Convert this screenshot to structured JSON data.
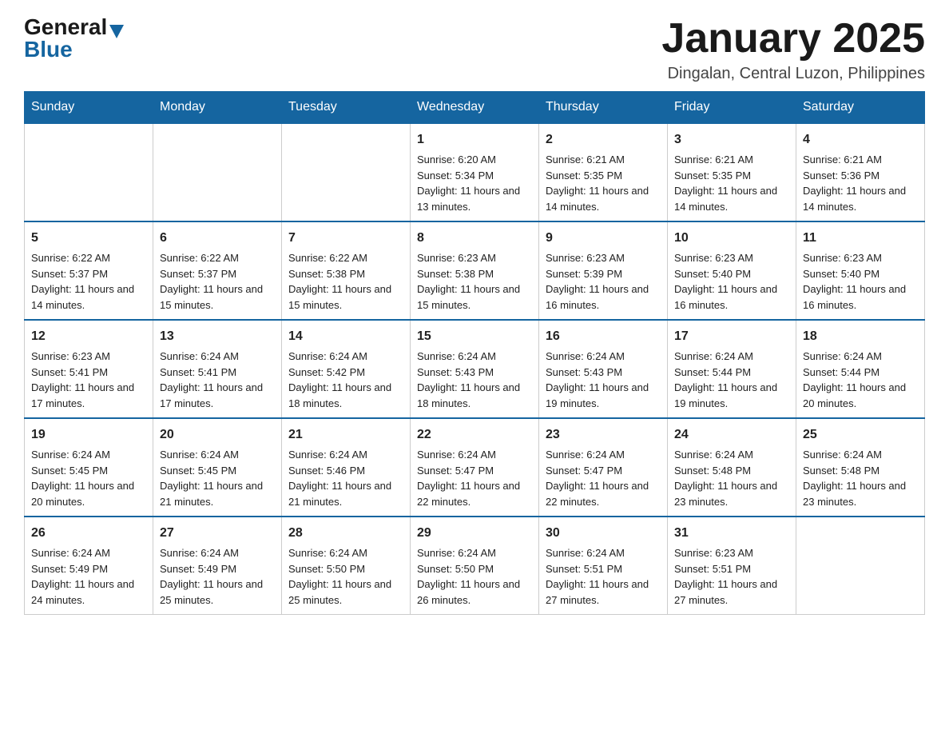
{
  "header": {
    "logo_general": "General",
    "logo_blue": "Blue",
    "title": "January 2025",
    "subtitle": "Dingalan, Central Luzon, Philippines"
  },
  "days_of_week": [
    "Sunday",
    "Monday",
    "Tuesday",
    "Wednesday",
    "Thursday",
    "Friday",
    "Saturday"
  ],
  "weeks": [
    [
      {
        "day": "",
        "info": ""
      },
      {
        "day": "",
        "info": ""
      },
      {
        "day": "",
        "info": ""
      },
      {
        "day": "1",
        "info": "Sunrise: 6:20 AM\nSunset: 5:34 PM\nDaylight: 11 hours and 13 minutes."
      },
      {
        "day": "2",
        "info": "Sunrise: 6:21 AM\nSunset: 5:35 PM\nDaylight: 11 hours and 14 minutes."
      },
      {
        "day": "3",
        "info": "Sunrise: 6:21 AM\nSunset: 5:35 PM\nDaylight: 11 hours and 14 minutes."
      },
      {
        "day": "4",
        "info": "Sunrise: 6:21 AM\nSunset: 5:36 PM\nDaylight: 11 hours and 14 minutes."
      }
    ],
    [
      {
        "day": "5",
        "info": "Sunrise: 6:22 AM\nSunset: 5:37 PM\nDaylight: 11 hours and 14 minutes."
      },
      {
        "day": "6",
        "info": "Sunrise: 6:22 AM\nSunset: 5:37 PM\nDaylight: 11 hours and 15 minutes."
      },
      {
        "day": "7",
        "info": "Sunrise: 6:22 AM\nSunset: 5:38 PM\nDaylight: 11 hours and 15 minutes."
      },
      {
        "day": "8",
        "info": "Sunrise: 6:23 AM\nSunset: 5:38 PM\nDaylight: 11 hours and 15 minutes."
      },
      {
        "day": "9",
        "info": "Sunrise: 6:23 AM\nSunset: 5:39 PM\nDaylight: 11 hours and 16 minutes."
      },
      {
        "day": "10",
        "info": "Sunrise: 6:23 AM\nSunset: 5:40 PM\nDaylight: 11 hours and 16 minutes."
      },
      {
        "day": "11",
        "info": "Sunrise: 6:23 AM\nSunset: 5:40 PM\nDaylight: 11 hours and 16 minutes."
      }
    ],
    [
      {
        "day": "12",
        "info": "Sunrise: 6:23 AM\nSunset: 5:41 PM\nDaylight: 11 hours and 17 minutes."
      },
      {
        "day": "13",
        "info": "Sunrise: 6:24 AM\nSunset: 5:41 PM\nDaylight: 11 hours and 17 minutes."
      },
      {
        "day": "14",
        "info": "Sunrise: 6:24 AM\nSunset: 5:42 PM\nDaylight: 11 hours and 18 minutes."
      },
      {
        "day": "15",
        "info": "Sunrise: 6:24 AM\nSunset: 5:43 PM\nDaylight: 11 hours and 18 minutes."
      },
      {
        "day": "16",
        "info": "Sunrise: 6:24 AM\nSunset: 5:43 PM\nDaylight: 11 hours and 19 minutes."
      },
      {
        "day": "17",
        "info": "Sunrise: 6:24 AM\nSunset: 5:44 PM\nDaylight: 11 hours and 19 minutes."
      },
      {
        "day": "18",
        "info": "Sunrise: 6:24 AM\nSunset: 5:44 PM\nDaylight: 11 hours and 20 minutes."
      }
    ],
    [
      {
        "day": "19",
        "info": "Sunrise: 6:24 AM\nSunset: 5:45 PM\nDaylight: 11 hours and 20 minutes."
      },
      {
        "day": "20",
        "info": "Sunrise: 6:24 AM\nSunset: 5:45 PM\nDaylight: 11 hours and 21 minutes."
      },
      {
        "day": "21",
        "info": "Sunrise: 6:24 AM\nSunset: 5:46 PM\nDaylight: 11 hours and 21 minutes."
      },
      {
        "day": "22",
        "info": "Sunrise: 6:24 AM\nSunset: 5:47 PM\nDaylight: 11 hours and 22 minutes."
      },
      {
        "day": "23",
        "info": "Sunrise: 6:24 AM\nSunset: 5:47 PM\nDaylight: 11 hours and 22 minutes."
      },
      {
        "day": "24",
        "info": "Sunrise: 6:24 AM\nSunset: 5:48 PM\nDaylight: 11 hours and 23 minutes."
      },
      {
        "day": "25",
        "info": "Sunrise: 6:24 AM\nSunset: 5:48 PM\nDaylight: 11 hours and 23 minutes."
      }
    ],
    [
      {
        "day": "26",
        "info": "Sunrise: 6:24 AM\nSunset: 5:49 PM\nDaylight: 11 hours and 24 minutes."
      },
      {
        "day": "27",
        "info": "Sunrise: 6:24 AM\nSunset: 5:49 PM\nDaylight: 11 hours and 25 minutes."
      },
      {
        "day": "28",
        "info": "Sunrise: 6:24 AM\nSunset: 5:50 PM\nDaylight: 11 hours and 25 minutes."
      },
      {
        "day": "29",
        "info": "Sunrise: 6:24 AM\nSunset: 5:50 PM\nDaylight: 11 hours and 26 minutes."
      },
      {
        "day": "30",
        "info": "Sunrise: 6:24 AM\nSunset: 5:51 PM\nDaylight: 11 hours and 27 minutes."
      },
      {
        "day": "31",
        "info": "Sunrise: 6:23 AM\nSunset: 5:51 PM\nDaylight: 11 hours and 27 minutes."
      },
      {
        "day": "",
        "info": ""
      }
    ]
  ]
}
